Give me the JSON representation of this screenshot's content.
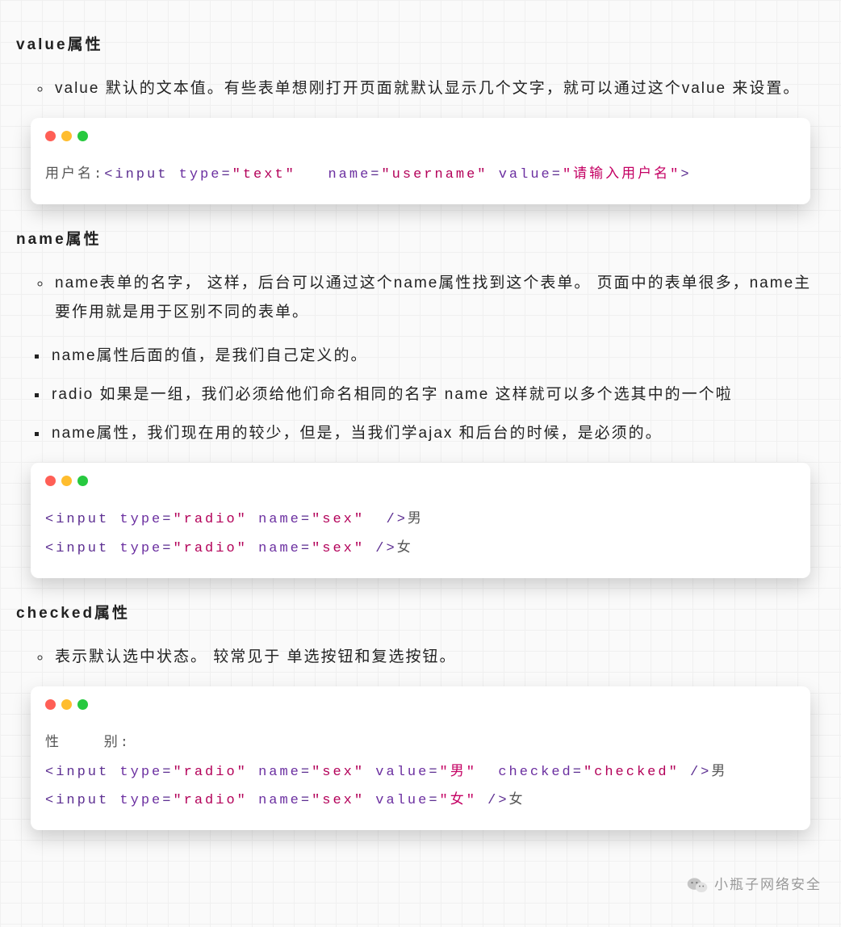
{
  "sections": [
    {
      "heading": "value属性",
      "bullets_primary": [
        "value 默认的文本值。有些表单想刚打开页面就默认显示几个文字，就可以通过这个value 来设置。"
      ],
      "code_lines": [
        [
          {
            "cls": "c-plain",
            "t": "用户名:"
          },
          {
            "cls": "c-tag",
            "t": "<input "
          },
          {
            "cls": "c-attr",
            "t": "type"
          },
          {
            "cls": "c-tag",
            "t": "="
          },
          {
            "cls": "c-val",
            "t": "\"text\""
          },
          {
            "cls": "c-tag",
            "t": "   "
          },
          {
            "cls": "c-attr",
            "t": "name"
          },
          {
            "cls": "c-tag",
            "t": "="
          },
          {
            "cls": "c-val",
            "t": "\"username\""
          },
          {
            "cls": "c-tag",
            "t": " "
          },
          {
            "cls": "c-attr",
            "t": "value"
          },
          {
            "cls": "c-tag",
            "t": "="
          },
          {
            "cls": "c-val2",
            "t": "\"请输入用户名\""
          },
          {
            "cls": "c-tag",
            "t": ">"
          }
        ]
      ]
    },
    {
      "heading": "name属性",
      "bullets_primary": [
        "name表单的名字， 这样，后台可以通过这个name属性找到这个表单。 页面中的表单很多，name主要作用就是用于区别不同的表单。"
      ],
      "bullets_secondary": [
        "name属性后面的值，是我们自己定义的。",
        "radio  如果是一组，我们必须给他们命名相同的名字 name   这样就可以多个选其中的一个啦",
        "name属性，我们现在用的较少，但是，当我们学ajax 和后台的时候，是必须的。"
      ],
      "code_lines": [
        [
          {
            "cls": "c-tag",
            "t": "<input "
          },
          {
            "cls": "c-attr",
            "t": "type"
          },
          {
            "cls": "c-tag",
            "t": "="
          },
          {
            "cls": "c-val",
            "t": "\"radio\""
          },
          {
            "cls": "c-tag",
            "t": " "
          },
          {
            "cls": "c-attr",
            "t": "name"
          },
          {
            "cls": "c-tag",
            "t": "="
          },
          {
            "cls": "c-val",
            "t": "\"sex\""
          },
          {
            "cls": "c-tag",
            "t": "  />"
          },
          {
            "cls": "c-plain",
            "t": "男"
          }
        ],
        [
          {
            "cls": "c-tag",
            "t": "<input "
          },
          {
            "cls": "c-attr",
            "t": "type"
          },
          {
            "cls": "c-tag",
            "t": "="
          },
          {
            "cls": "c-val",
            "t": "\"radio\""
          },
          {
            "cls": "c-tag",
            "t": " "
          },
          {
            "cls": "c-attr",
            "t": "name"
          },
          {
            "cls": "c-tag",
            "t": "="
          },
          {
            "cls": "c-val",
            "t": "\"sex\""
          },
          {
            "cls": "c-tag",
            "t": " />"
          },
          {
            "cls": "c-plain",
            "t": "女"
          }
        ]
      ]
    },
    {
      "heading": "checked属性",
      "bullets_primary": [
        "表示默认选中状态。  较常见于 单选按钮和复选按钮。"
      ],
      "code_lines": [
        [
          {
            "cls": "c-plain",
            "t": "性    别:"
          }
        ],
        [
          {
            "cls": "c-tag",
            "t": "<input "
          },
          {
            "cls": "c-attr",
            "t": "type"
          },
          {
            "cls": "c-tag",
            "t": "="
          },
          {
            "cls": "c-val",
            "t": "\"radio\""
          },
          {
            "cls": "c-tag",
            "t": " "
          },
          {
            "cls": "c-attr",
            "t": "name"
          },
          {
            "cls": "c-tag",
            "t": "="
          },
          {
            "cls": "c-val",
            "t": "\"sex\""
          },
          {
            "cls": "c-tag",
            "t": " "
          },
          {
            "cls": "c-attr",
            "t": "value"
          },
          {
            "cls": "c-tag",
            "t": "="
          },
          {
            "cls": "c-val2",
            "t": "\"男\""
          },
          {
            "cls": "c-tag",
            "t": "  "
          },
          {
            "cls": "c-attr",
            "t": "checked"
          },
          {
            "cls": "c-tag",
            "t": "="
          },
          {
            "cls": "c-val",
            "t": "\"checked\""
          },
          {
            "cls": "c-tag",
            "t": " />"
          },
          {
            "cls": "c-plain",
            "t": "男"
          }
        ],
        [
          {
            "cls": "c-tag",
            "t": "<input "
          },
          {
            "cls": "c-attr",
            "t": "type"
          },
          {
            "cls": "c-tag",
            "t": "="
          },
          {
            "cls": "c-val",
            "t": "\"radio\""
          },
          {
            "cls": "c-tag",
            "t": " "
          },
          {
            "cls": "c-attr",
            "t": "name"
          },
          {
            "cls": "c-tag",
            "t": "="
          },
          {
            "cls": "c-val",
            "t": "\"sex\""
          },
          {
            "cls": "c-tag",
            "t": " "
          },
          {
            "cls": "c-attr",
            "t": "value"
          },
          {
            "cls": "c-tag",
            "t": "="
          },
          {
            "cls": "c-val2",
            "t": "\"女\""
          },
          {
            "cls": "c-tag",
            "t": " />"
          },
          {
            "cls": "c-plain",
            "t": "女"
          }
        ]
      ]
    }
  ],
  "watermark": "小瓶子网络安全"
}
